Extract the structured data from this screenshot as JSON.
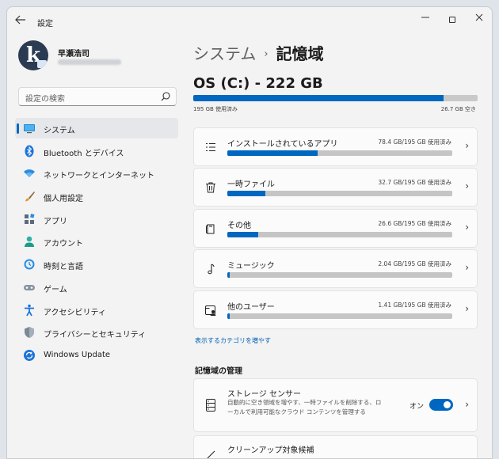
{
  "window": {
    "app_title": "設定",
    "back_icon": "back-arrow-icon",
    "controls": [
      "minimize-icon",
      "maximize-icon",
      "close-icon"
    ]
  },
  "profile": {
    "name": "早瀬浩司"
  },
  "search": {
    "placeholder": "設定の検索"
  },
  "sidebar": {
    "items": [
      {
        "label": "システム",
        "icon": "system-icon",
        "active": true
      },
      {
        "label": "Bluetooth とデバイス",
        "icon": "bluetooth-icon"
      },
      {
        "label": "ネットワークとインターネット",
        "icon": "wifi-icon"
      },
      {
        "label": "個人用設定",
        "icon": "brush-icon"
      },
      {
        "label": "アプリ",
        "icon": "apps-icon"
      },
      {
        "label": "アカウント",
        "icon": "account-icon"
      },
      {
        "label": "時刻と言語",
        "icon": "time-language-icon"
      },
      {
        "label": "ゲーム",
        "icon": "gamepad-icon"
      },
      {
        "label": "アクセシビリティ",
        "icon": "accessibility-icon"
      },
      {
        "label": "プライバシーとセキュリティ",
        "icon": "shield-icon"
      },
      {
        "label": "Windows Update",
        "icon": "windows-update-icon"
      }
    ]
  },
  "breadcrumb": {
    "parent": "システム",
    "separator": "›",
    "current": "記憶域"
  },
  "drive": {
    "title": "OS (C:) - 222 GB",
    "used_label": "195 GB 使用済み",
    "free_label": "26.7 GB 空き",
    "used_fraction": 0.879
  },
  "categories": [
    {
      "name": "インストールされているアプリ",
      "usage": "78.4 GB/195 GB 使用済み",
      "fraction": 0.402,
      "icon": "apps-list-icon"
    },
    {
      "name": "一時ファイル",
      "usage": "32.7 GB/195 GB 使用済み",
      "fraction": 0.168,
      "icon": "trash-icon"
    },
    {
      "name": "その他",
      "usage": "26.6 GB/195 GB 使用済み",
      "fraction": 0.136,
      "icon": "other-files-icon"
    },
    {
      "name": "ミュージック",
      "usage": "2.04 GB/195 GB 使用済み",
      "fraction": 0.012,
      "icon": "music-note-icon"
    },
    {
      "name": "他のユーザー",
      "usage": "1.41 GB/195 GB 使用済み",
      "fraction": 0.008,
      "icon": "other-users-icon"
    }
  ],
  "more_link": "表示するカテゴリを増やす",
  "management": {
    "title": "記憶域の管理",
    "storage_sense": {
      "title": "ストレージ センサー",
      "description": "自動的に空き領域を増やす、一時ファイルを削除する、ローカルで利用可能なクラウド コンテンツを管理する",
      "toggle_label": "オン",
      "toggle_on": true
    },
    "cleanup": {
      "title": "クリーンアップ対象候補"
    }
  },
  "colors": {
    "accent": "#0067c0",
    "bar_track": "#c5c5c5",
    "card_bg": "#fbfbfb",
    "window_bg": "#f3f3f3"
  }
}
